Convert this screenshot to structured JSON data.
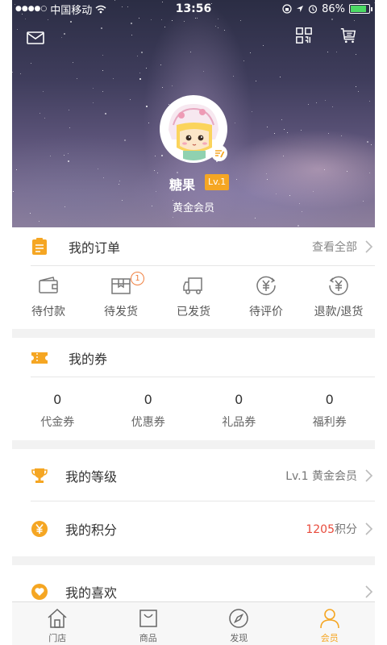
{
  "status_bar": {
    "carrier": "中国移动",
    "time": "13:56",
    "battery": "86%",
    "battery_level": 0.86
  },
  "profile": {
    "username": "糖果",
    "level": "Lv.1",
    "member_type": "黄金会员"
  },
  "orders": {
    "title": "我的订单",
    "view_all": "查看全部",
    "items": [
      {
        "label": "待付款",
        "icon": "wallet-icon"
      },
      {
        "label": "待发货",
        "icon": "box-icon",
        "badge": "1"
      },
      {
        "label": "已发货",
        "icon": "truck-icon"
      },
      {
        "label": "待评价",
        "icon": "yen-review-icon"
      },
      {
        "label": "退款/退货",
        "icon": "yen-refund-icon"
      }
    ]
  },
  "coupons": {
    "title": "我的券",
    "items": [
      {
        "value": "0",
        "label": "代金券"
      },
      {
        "value": "0",
        "label": "优惠券"
      },
      {
        "value": "0",
        "label": "礼品券"
      },
      {
        "value": "0",
        "label": "福利券"
      }
    ]
  },
  "level_row": {
    "label": "我的等级",
    "value": "Lv.1 黄金会员"
  },
  "points_row": {
    "label": "我的积分",
    "points": "1205",
    "unit": "积分"
  },
  "favorites_row": {
    "label": "我的喜欢"
  },
  "tabs": [
    {
      "label": "门店",
      "icon": "store-icon"
    },
    {
      "label": "商品",
      "icon": "bag-icon"
    },
    {
      "label": "发现",
      "icon": "compass-icon"
    },
    {
      "label": "会员",
      "icon": "member-icon",
      "active": true
    }
  ],
  "colors": {
    "accent": "#f5a623",
    "points_red": "#e84b3c"
  }
}
